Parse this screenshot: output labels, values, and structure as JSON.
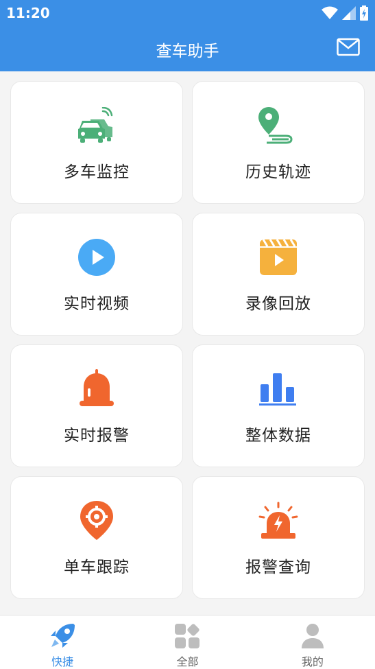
{
  "status_bar": {
    "time": "11:20",
    "icons": [
      "wifi-icon",
      "signal-icon",
      "battery-charging-icon"
    ]
  },
  "app_bar": {
    "title": "查车助手",
    "action_icon": "mail-icon"
  },
  "menu": [
    {
      "label": "多车监控",
      "icon": "multi-car-monitor-icon",
      "color": "#4caf78"
    },
    {
      "label": "历史轨迹",
      "icon": "location-track-icon",
      "color": "#4caf78"
    },
    {
      "label": "实时视频",
      "icon": "play-circle-icon",
      "color": "#4aaaf5"
    },
    {
      "label": "录像回放",
      "icon": "video-clapper-icon",
      "color": "#f5b13d"
    },
    {
      "label": "实时报警",
      "icon": "alarm-bell-icon",
      "color": "#f0662e"
    },
    {
      "label": "整体数据",
      "icon": "bar-chart-icon",
      "color": "#3f7ef0"
    },
    {
      "label": "单车跟踪",
      "icon": "target-pin-icon",
      "color": "#f0662e"
    },
    {
      "label": "报警查询",
      "icon": "siren-icon",
      "color": "#f0662e"
    }
  ],
  "bottom_nav": {
    "items": [
      {
        "label": "快捷",
        "icon": "rocket-icon",
        "active": true
      },
      {
        "label": "全部",
        "icon": "grid-apps-icon",
        "active": false
      },
      {
        "label": "我的",
        "icon": "user-icon",
        "active": false
      }
    ]
  },
  "colors": {
    "primary": "#3b8fe6",
    "background": "#f4f4f4",
    "card": "#ffffff",
    "inactive": "#bdbdbd"
  }
}
